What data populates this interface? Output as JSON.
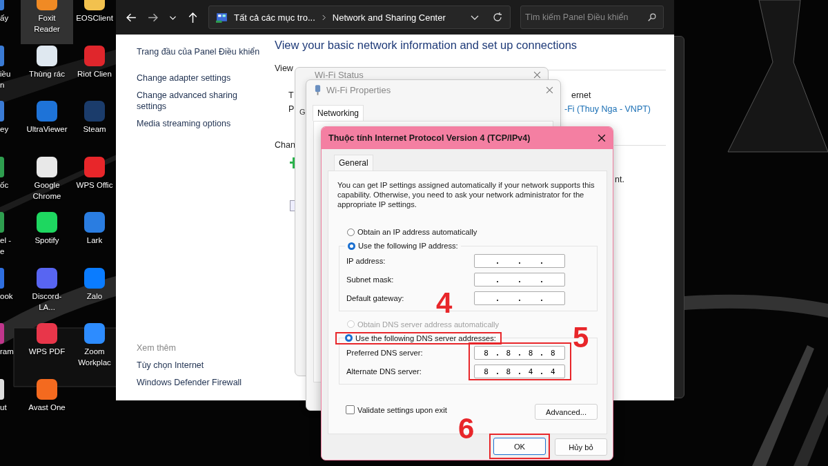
{
  "desktop": {
    "columns": [
      {
        "icons": [
          {
            "label": "ấy",
            "selected": false
          },
          {
            "label": "iều n",
            "selected": false
          },
          {
            "label": "ey",
            "selected": false
          },
          {
            "label": "ốc",
            "selected": false
          },
          {
            "label": "el - e",
            "selected": false
          },
          {
            "label": "ook",
            "selected": false
          },
          {
            "label": "ram",
            "selected": false
          },
          {
            "label": "ut",
            "selected": false
          }
        ]
      },
      {
        "icons": [
          {
            "label": "Foxit Reader",
            "selected": true
          },
          {
            "label": "Thùng rác",
            "selected": false
          },
          {
            "label": "UltraViewer",
            "selected": false
          },
          {
            "label": "Google Chrome",
            "selected": false
          },
          {
            "label": "Spotify",
            "selected": false
          },
          {
            "label": "Discord-LA...",
            "selected": false
          },
          {
            "label": "WPS PDF",
            "selected": false
          },
          {
            "label": "Avast One",
            "selected": false
          }
        ]
      },
      {
        "icons": [
          {
            "label": "EOSClient",
            "selected": false
          },
          {
            "label": "Riot Clien",
            "selected": false
          },
          {
            "label": "Steam",
            "selected": false
          },
          {
            "label": "WPS Offic",
            "selected": false
          },
          {
            "label": "Lark",
            "selected": false
          },
          {
            "label": "Zalo",
            "selected": false
          },
          {
            "label": "Zoom Workplac",
            "selected": false
          }
        ]
      }
    ]
  },
  "explorer": {
    "breadcrumb": [
      "Tất cả các mục tro...",
      "Network and Sharing Center"
    ],
    "search": {
      "placeholder": "Tìm kiếm Panel Điều khiển"
    },
    "sidebar": {
      "items": [
        "Trang đầu của Panel Điều khiển",
        "Change adapter settings",
        "Change advanced sharing settings",
        "Media streaming options"
      ],
      "see_also_heading": "Xem thêm",
      "see_also": [
        "Tùy chọn Internet",
        "Windows Defender Firewall"
      ]
    },
    "heading": "View your basic network information and set up connections",
    "fragments": [
      {
        "kind": "label",
        "text": "View"
      },
      {
        "kind": "label",
        "text": "T"
      },
      {
        "kind": "label",
        "text": "P"
      },
      {
        "kind": "label",
        "text": "ernet"
      },
      {
        "kind": "link",
        "text": "-Fi (Thuy Nga - VNPT)"
      },
      {
        "kind": "label",
        "text": "Chan"
      },
      {
        "kind": "label",
        "text": "nt."
      }
    ]
  },
  "wifi_status": {
    "title": "Wi-Fi Status",
    "tab": "G"
  },
  "wifi_properties": {
    "title": "Wi-Fi Properties",
    "tab": "Networking"
  },
  "ipv4_dialog": {
    "title": "Thuộc tính Internet Protocol Version 4 (TCP/IPv4)",
    "tab": "General",
    "description": "You can get IP settings assigned automatically if your network supports this capability. Otherwise, you need to ask your network administrator for the appropriate IP settings.",
    "ip_section": {
      "options": [
        {
          "label": "Obtain an IP address automatically",
          "selected": false,
          "disabled": false,
          "highlighted": false
        },
        {
          "label": "Use the following IP address:",
          "selected": true,
          "disabled": false,
          "highlighted": false
        }
      ],
      "highlighted": false,
      "fields": [
        {
          "label": "IP address:"
        },
        {
          "label": "Subnet mask:"
        },
        {
          "label": "Default gateway:"
        }
      ]
    },
    "dns_section": {
      "options": [
        {
          "label": "Obtain DNS server address automatically",
          "selected": false,
          "disabled": true,
          "highlighted": false
        },
        {
          "label": "Use the following DNS server addresses:",
          "selected": true,
          "disabled": false,
          "highlighted": true
        }
      ],
      "highlighted": true,
      "fields": [
        {
          "label": "Preferred DNS server:",
          "octets": [
            "8",
            "8",
            "8",
            "8"
          ]
        },
        {
          "label": "Alternate DNS server:",
          "octets": [
            "8",
            "8",
            "4",
            "4"
          ]
        }
      ]
    },
    "validate": {
      "label": "Validate settings upon exit",
      "checked": false
    },
    "advanced_button": "Advanced...",
    "buttons": [
      {
        "label": "OK",
        "highlighted": true
      },
      {
        "label": "Hủy bỏ",
        "highlighted": false
      }
    ]
  },
  "annotations": [
    {
      "label": "4"
    },
    {
      "label": "5"
    },
    {
      "label": "6"
    }
  ]
}
